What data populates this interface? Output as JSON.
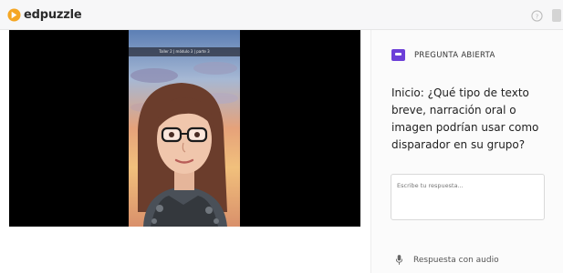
{
  "header": {
    "brand": "edpuzzle",
    "icons": {
      "logo": "edpuzzle-logo-icon",
      "help": "help-circle-icon",
      "account": "account-icon"
    }
  },
  "video": {
    "caption": "Taller 2 | módulo 3 | parte 3",
    "icons": {
      "frame": "webcam-video-frame"
    }
  },
  "question": {
    "type_label": "PREGUNTA ABIERTA",
    "text": "Inicio: ¿Qué tipo de texto breve, narración oral o imagen podrían usar como disparador en su grupo?",
    "icon": "open-question-icon",
    "accent_color": "#6c3fd8"
  },
  "answer": {
    "placeholder": "Escribe tu respuesta...",
    "value": ""
  },
  "audio": {
    "label": "Respuesta con audio",
    "icon": "microphone-icon"
  }
}
